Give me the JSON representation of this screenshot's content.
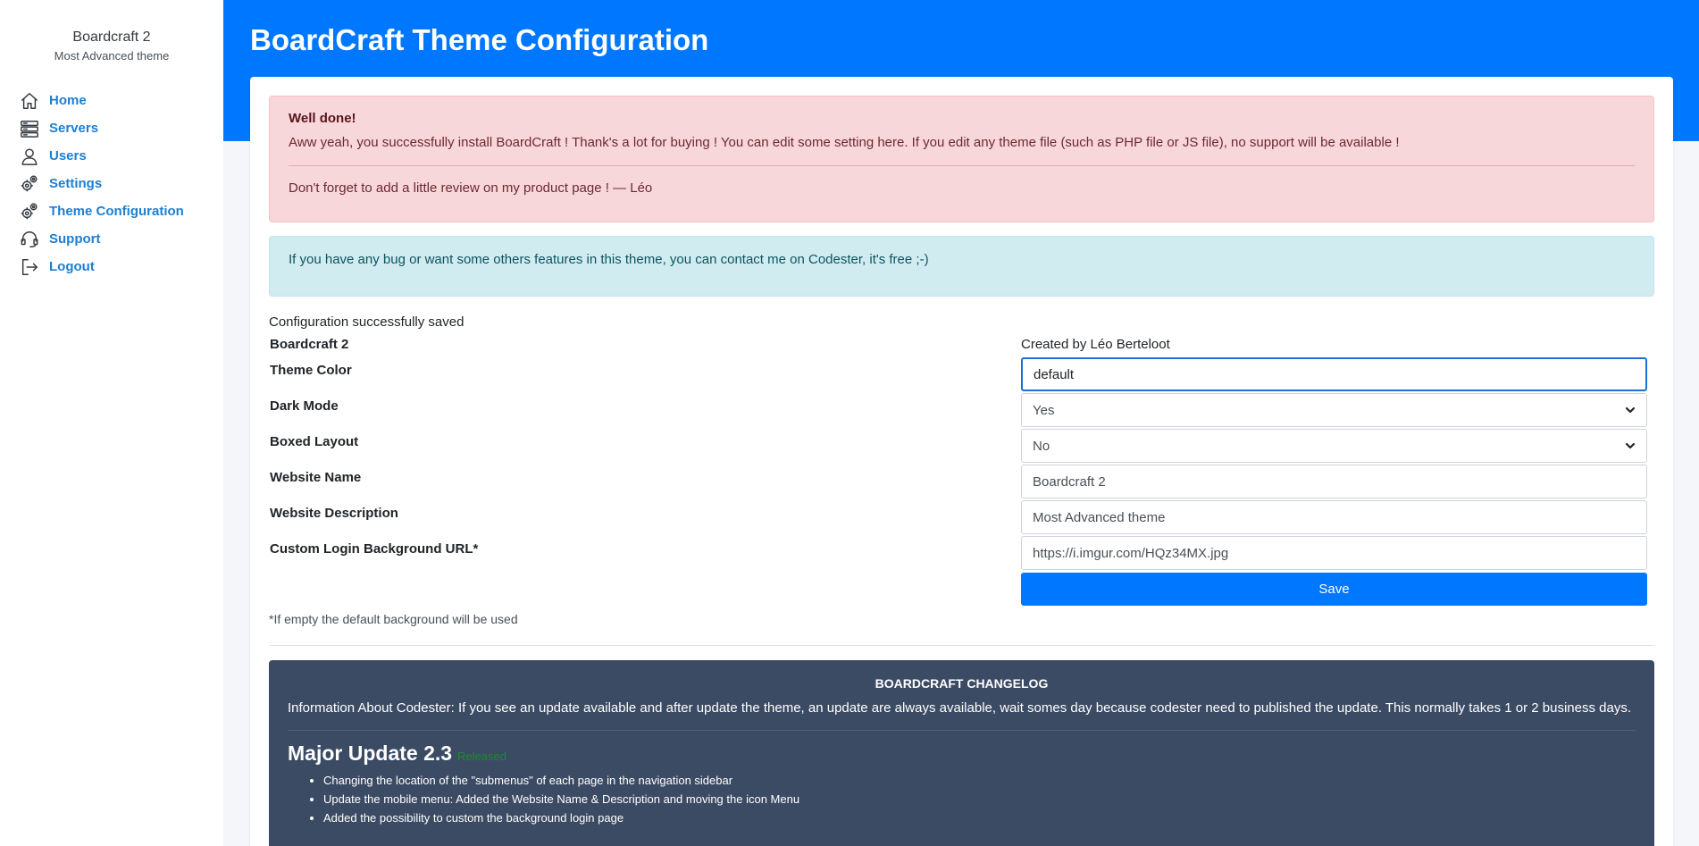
{
  "sidebar": {
    "brand_name": "Boardcraft 2",
    "brand_desc": "Most Advanced theme",
    "items": [
      {
        "label": "Home",
        "icon": "home-icon"
      },
      {
        "label": "Servers",
        "icon": "servers-icon"
      },
      {
        "label": "Users",
        "icon": "user-icon"
      },
      {
        "label": "Settings",
        "icon": "gears-icon"
      },
      {
        "label": "Theme Configuration",
        "icon": "gears-icon"
      },
      {
        "label": "Support",
        "icon": "headset-icon"
      },
      {
        "label": "Logout",
        "icon": "logout-icon"
      }
    ]
  },
  "header": {
    "title": "BoardCraft Theme Configuration",
    "color": "#0077ff"
  },
  "alert_success": {
    "heading": "Well done!",
    "message": "Aww yeah, you successfully install BoardCraft ! Thank's a lot for buying ! You can edit some setting here. If you edit any theme file (such as PHP file or JS file), no support will be available !",
    "footer": "Don't forget to add a little review on my product page ! — Léo"
  },
  "alert_info": {
    "message": "If you have any bug or want some others features in this theme, you can contact me on Codester, it's free ;-)"
  },
  "form": {
    "saved_message": "Configuration successfully saved",
    "app_name": "Boardcraft 2",
    "creator": "Created by Léo Berteloot",
    "theme_color_label": "Theme Color",
    "theme_color_value": "default",
    "dark_mode_label": "Dark Mode",
    "dark_mode_value": "Yes",
    "boxed_layout_label": "Boxed Layout",
    "boxed_layout_value": "No",
    "website_name_label": "Website Name",
    "website_name_value": "Boardcraft 2",
    "website_desc_label": "Website Description",
    "website_desc_value": "Most Advanced theme",
    "login_bg_label": "Custom Login Background URL*",
    "login_bg_value": "https://i.imgur.com/HQz34MX.jpg",
    "save_label": "Save",
    "note": "*If empty the default background will be used"
  },
  "changelog": {
    "title": "BOARDCRAFT CHANGELOG",
    "info": "Information About Codester: If you see an update available and after update the theme, an update are always available, wait somes day because codester need to published the update. This normally takes 1 or 2 business days.",
    "version": "Major Update 2.3",
    "badge": "Released",
    "items": [
      "Changing the location of the \"submenus\" of each page in the navigation sidebar",
      "Update the mobile menu: Added the Website Name & Description and moving the icon Menu",
      "Added the possibility to custom the background login page"
    ]
  }
}
